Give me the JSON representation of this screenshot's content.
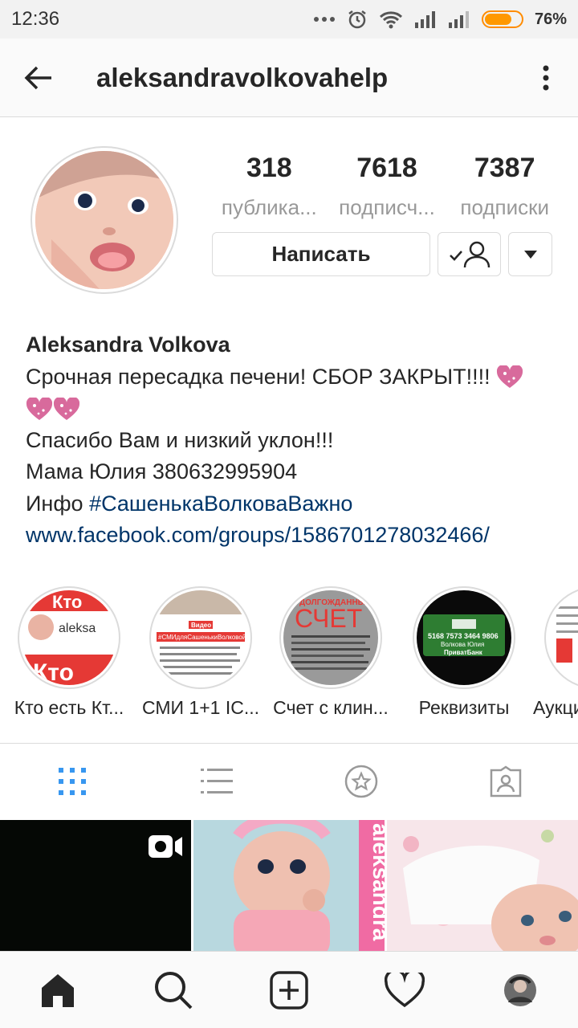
{
  "status_bar": {
    "time": "12:36",
    "battery": "76%",
    "battery_level": 0.76
  },
  "header": {
    "username": "aleksandravolkovahelp"
  },
  "profile": {
    "stats": [
      {
        "value": "318",
        "label": "публика..."
      },
      {
        "value": "7618",
        "label": "подписч..."
      },
      {
        "value": "7387",
        "label": "подписки"
      }
    ],
    "message_label": "Написать",
    "name": "Aleksandra Volkova",
    "bio_line1": "Срочная пересадка печени! СБОР ЗАКРЫТ!!!!",
    "bio_line2": "Спасибо Вам и низкий уклон!!!",
    "bio_line3": "Мама Юлия 380632995904",
    "bio_info_prefix": "Инфо",
    "bio_hashtag": "#СашенькаВолковаВажно",
    "bio_link": "www.facebook.com/groups/1586701278032466/"
  },
  "highlights": [
    {
      "label": "Кто есть Кт..."
    },
    {
      "label": "СМИ 1+1 IC..."
    },
    {
      "label": "Счет с клин..."
    },
    {
      "label": "Реквизиты"
    },
    {
      "label": "Аукци"
    }
  ],
  "highlight_image_text": {
    "h1_top": "Кто",
    "h1_mid": "aleksa",
    "h1_bottom": "Кто",
    "h2_badge": "Видео",
    "h2_tag": "#СМИдляСашенькиВолковой",
    "h3_top": "ДОЛГОЖДАННЫ",
    "h3_big": "СЧЕТ",
    "h4_card": "5168 7573 3464 9806",
    "h4_name": "Волкова Юлия",
    "h4_bank": "ПриватБанк"
  },
  "grid_image_text": {
    "side_text": "aleksandra"
  },
  "colors": {
    "link": "#003569",
    "active_tab": "#3897f0",
    "divider": "#dbdbdb",
    "heart": "#d86a9c"
  }
}
